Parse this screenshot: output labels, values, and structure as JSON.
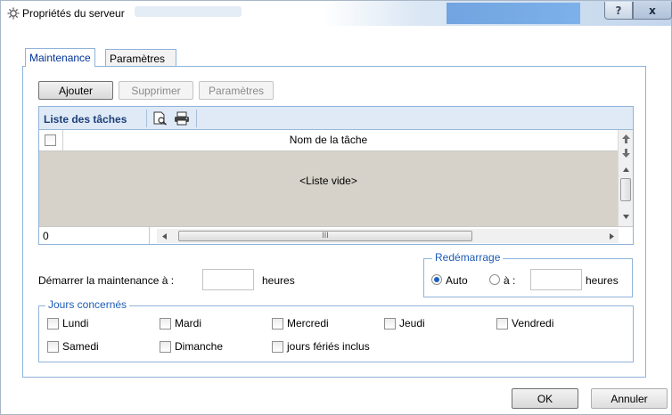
{
  "window": {
    "title": "Propriétés du serveur",
    "help_label": "?",
    "close_label": "x"
  },
  "tabs": [
    {
      "label": "Maintenance",
      "active": true
    },
    {
      "label": "Paramètres",
      "active": false
    }
  ],
  "toolbar": {
    "add_label": "Ajouter",
    "delete_label": "Supprimer",
    "params_label": "Paramètres"
  },
  "task_list": {
    "title": "Liste des tâches",
    "column_name": "Nom de la tâche",
    "empty_text": "<Liste vide>",
    "count": "0",
    "hscroll_grip": "III"
  },
  "maintenance": {
    "start_label": "Démarrer la maintenance à :",
    "start_value": "",
    "hours_label": "heures"
  },
  "restart": {
    "group_title": "Redémarrage",
    "auto_label": "Auto",
    "at_label": "à :",
    "at_value": "",
    "hours_label": "heures"
  },
  "days": {
    "group_title": "Jours concernés",
    "items": [
      {
        "label": "Lundi",
        "checked": false
      },
      {
        "label": "Mardi",
        "checked": false
      },
      {
        "label": "Mercredi",
        "checked": false
      },
      {
        "label": "Jeudi",
        "checked": false
      },
      {
        "label": "Vendredi",
        "checked": false
      },
      {
        "label": "Samedi",
        "checked": false
      },
      {
        "label": "Dimanche",
        "checked": false
      },
      {
        "label": "jours fériés inclus",
        "checked": false
      }
    ]
  },
  "footer": {
    "ok_label": "OK",
    "cancel_label": "Annuler"
  },
  "colors": {
    "accent": "#1d5bb6",
    "list_body": "#d6d2c9",
    "header_band": "#dfeaf6"
  }
}
